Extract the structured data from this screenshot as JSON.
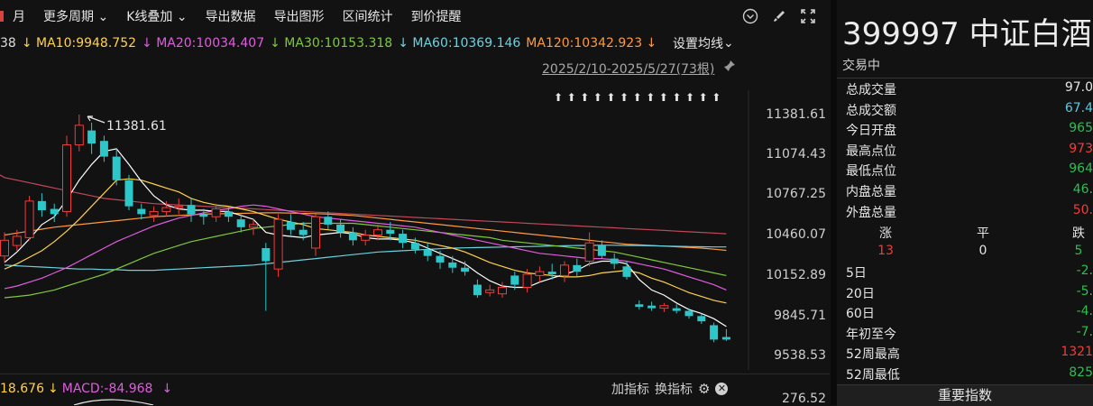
{
  "toolbar": {
    "items": [
      "月",
      "更多周期",
      "K线叠加",
      "导出数据",
      "导出图形",
      "区间统计",
      "到价提醒"
    ]
  },
  "ma": {
    "prefix": "38",
    "ma10": "MA10:9948.752",
    "ma20": "MA20:10034.407",
    "ma30": "MA30:10153.318",
    "ma60": "MA60:10369.146",
    "ma120": "MA120:10342.923",
    "settings": "设置均线"
  },
  "range_label": "2025/2/10-2025/5/27(73根)",
  "high_label": "11381.61",
  "axis": [
    "11381.61",
    "11074.43",
    "10767.25",
    "10460.07",
    "10152.89",
    "9845.71",
    "9538.53"
  ],
  "macd": {
    "prefix": "18.676",
    "macd": "MACD:-84.968",
    "add": "加指标",
    "switch": "换指标",
    "axis_val": "276.52"
  },
  "quote": {
    "title": "399997 中证白酒",
    "status": "交易中",
    "rows": [
      {
        "label": "总成交量",
        "value": "97.0",
        "color": "#e6e6e6"
      },
      {
        "label": "总成交额",
        "value": "67.4",
        "color": "#5ec8e0"
      },
      {
        "label": "今日开盘",
        "value": "965",
        "color": "#2bbf4f"
      },
      {
        "label": "最高点位",
        "value": "973",
        "color": "#f03c3c"
      },
      {
        "label": "最低点位",
        "value": "964",
        "color": "#2bbf4f"
      },
      {
        "label": "内盘总量",
        "value": "46.",
        "color": "#2bbf4f"
      },
      {
        "label": "外盘总量",
        "value": "50.",
        "color": "#f03c3c"
      }
    ],
    "updown_labels": [
      "涨",
      "平",
      "跌"
    ],
    "updown_values": [
      "13",
      "0",
      "5"
    ],
    "perf": [
      {
        "label": "5日",
        "value": "-2.",
        "color": "#2bbf4f"
      },
      {
        "label": "20日",
        "value": "-5.",
        "color": "#2bbf4f"
      },
      {
        "label": "60日",
        "value": "-4.",
        "color": "#2bbf4f"
      },
      {
        "label": "年初至今",
        "value": "-7.",
        "color": "#2bbf4f"
      },
      {
        "label": "52周最高",
        "value": "1321",
        "color": "#f03c3c"
      },
      {
        "label": "52周最低",
        "value": "825",
        "color": "#2bbf4f"
      }
    ],
    "bottom_button": "重要指数"
  },
  "colors": {
    "up": "#f03c3c",
    "down": "#2ec7c9",
    "ma10": "#ffd24a",
    "ma20": "#e05ce0",
    "ma30": "#7fc93a",
    "ma60": "#6ad3e0",
    "ma120": "#ff9a3c"
  },
  "chart_data": {
    "type": "candlestick",
    "ylim": [
      9538.53,
      11381.61
    ],
    "candles": [
      {
        "o": 10300,
        "c": 10420,
        "h": 10480,
        "l": 10250
      },
      {
        "o": 10380,
        "c": 10450,
        "h": 10500,
        "l": 10340
      },
      {
        "o": 10440,
        "c": 10720,
        "h": 10760,
        "l": 10420
      },
      {
        "o": 10720,
        "c": 10650,
        "h": 10780,
        "l": 10600
      },
      {
        "o": 10660,
        "c": 10620,
        "h": 10700,
        "l": 10560
      },
      {
        "o": 10640,
        "c": 11150,
        "h": 11220,
        "l": 10600
      },
      {
        "o": 11150,
        "c": 11300,
        "h": 11381.61,
        "l": 11100
      },
      {
        "o": 11260,
        "c": 11160,
        "h": 11320,
        "l": 11080
      },
      {
        "o": 11180,
        "c": 11060,
        "h": 11220,
        "l": 11020
      },
      {
        "o": 11060,
        "c": 10880,
        "h": 11120,
        "l": 10840
      },
      {
        "o": 10880,
        "c": 10680,
        "h": 10920,
        "l": 10650
      },
      {
        "o": 10660,
        "c": 10620,
        "h": 10700,
        "l": 10580
      },
      {
        "o": 10610,
        "c": 10640,
        "h": 10680,
        "l": 10560
      },
      {
        "o": 10640,
        "c": 10670,
        "h": 10720,
        "l": 10600
      },
      {
        "o": 10670,
        "c": 10680,
        "h": 10740,
        "l": 10620
      },
      {
        "o": 10690,
        "c": 10620,
        "h": 10740,
        "l": 10560
      },
      {
        "o": 10620,
        "c": 10600,
        "h": 10660,
        "l": 10540
      },
      {
        "o": 10600,
        "c": 10660,
        "h": 10700,
        "l": 10560
      },
      {
        "o": 10640,
        "c": 10600,
        "h": 10680,
        "l": 10560
      },
      {
        "o": 10580,
        "c": 10520,
        "h": 10620,
        "l": 10480
      },
      {
        "o": 10520,
        "c": 10540,
        "h": 10580,
        "l": 10460
      },
      {
        "o": 10360,
        "c": 10260,
        "h": 10400,
        "l": 9880
      },
      {
        "o": 10200,
        "c": 10580,
        "h": 10620,
        "l": 10140
      },
      {
        "o": 10560,
        "c": 10500,
        "h": 10620,
        "l": 10460
      },
      {
        "o": 10500,
        "c": 10460,
        "h": 10560,
        "l": 10420
      },
      {
        "o": 10360,
        "c": 10600,
        "h": 10620,
        "l": 10300
      },
      {
        "o": 10600,
        "c": 10540,
        "h": 10640,
        "l": 10500
      },
      {
        "o": 10540,
        "c": 10480,
        "h": 10580,
        "l": 10440
      },
      {
        "o": 10480,
        "c": 10420,
        "h": 10520,
        "l": 10380
      },
      {
        "o": 10420,
        "c": 10460,
        "h": 10500,
        "l": 10380
      },
      {
        "o": 10460,
        "c": 10500,
        "h": 10540,
        "l": 10420
      },
      {
        "o": 10500,
        "c": 10470,
        "h": 10560,
        "l": 10420
      },
      {
        "o": 10470,
        "c": 10400,
        "h": 10500,
        "l": 10360
      },
      {
        "o": 10400,
        "c": 10350,
        "h": 10440,
        "l": 10320
      },
      {
        "o": 10350,
        "c": 10300,
        "h": 10400,
        "l": 10260
      },
      {
        "o": 10300,
        "c": 10250,
        "h": 10340,
        "l": 10200
      },
      {
        "o": 10250,
        "c": 10210,
        "h": 10300,
        "l": 10170
      },
      {
        "o": 10210,
        "c": 10180,
        "h": 10260,
        "l": 10150
      },
      {
        "o": 10080,
        "c": 10000,
        "h": 10120,
        "l": 9980
      },
      {
        "o": 10020,
        "c": 10040,
        "h": 10080,
        "l": 9990
      },
      {
        "o": 10010,
        "c": 10060,
        "h": 10100,
        "l": 9980
      },
      {
        "o": 10150,
        "c": 10080,
        "h": 10180,
        "l": 10040
      },
      {
        "o": 10060,
        "c": 10160,
        "h": 10200,
        "l": 10020
      },
      {
        "o": 10150,
        "c": 10180,
        "h": 10220,
        "l": 10100
      },
      {
        "o": 10180,
        "c": 10160,
        "h": 10240,
        "l": 10120
      },
      {
        "o": 10150,
        "c": 10230,
        "h": 10260,
        "l": 10100
      },
      {
        "o": 10230,
        "c": 10180,
        "h": 10280,
        "l": 10140
      },
      {
        "o": 10260,
        "c": 10400,
        "h": 10480,
        "l": 10220
      },
      {
        "o": 10380,
        "c": 10300,
        "h": 10420,
        "l": 10280
      },
      {
        "o": 10280,
        "c": 10240,
        "h": 10320,
        "l": 10200
      },
      {
        "o": 10220,
        "c": 10140,
        "h": 10260,
        "l": 10120
      },
      {
        "o": 9930,
        "c": 9910,
        "h": 9960,
        "l": 9890
      },
      {
        "o": 9920,
        "c": 9900,
        "h": 9950,
        "l": 9880
      },
      {
        "o": 9900,
        "c": 9920,
        "h": 9940,
        "l": 9870
      },
      {
        "o": 9900,
        "c": 9880,
        "h": 9930,
        "l": 9860
      },
      {
        "o": 9880,
        "c": 9840,
        "h": 9900,
        "l": 9820
      },
      {
        "o": 9840,
        "c": 9800,
        "h": 9860,
        "l": 9780
      },
      {
        "o": 9770,
        "c": 9660,
        "h": 9790,
        "l": 9640
      },
      {
        "o": 9680,
        "c": 9660,
        "h": 9740,
        "l": 9650
      }
    ],
    "ma_lines": {
      "ma5": [
        10250,
        10330,
        10430,
        10540,
        10600,
        10730,
        10880,
        11000,
        11100,
        11120,
        11000,
        10870,
        10760,
        10690,
        10660,
        10650,
        10650,
        10640,
        10640,
        10610,
        10580,
        10480,
        10460,
        10450,
        10440,
        10460,
        10470,
        10480,
        10470,
        10440,
        10430,
        10430,
        10420,
        10400,
        10360,
        10320,
        10280,
        10240,
        10170,
        10110,
        10070,
        10060,
        10060,
        10100,
        10130,
        10160,
        10190,
        10240,
        10260,
        10260,
        10240,
        10120,
        10040,
        10000,
        9940,
        9890,
        9860,
        9820,
        9760
      ],
      "ma10": [
        10200,
        10240,
        10290,
        10340,
        10410,
        10490,
        10580,
        10680,
        10780,
        10880,
        10890,
        10880,
        10850,
        10820,
        10790,
        10740,
        10710,
        10690,
        10680,
        10660,
        10640,
        10610,
        10580,
        10560,
        10540,
        10510,
        10500,
        10490,
        10480,
        10460,
        10450,
        10440,
        10430,
        10420,
        10400,
        10380,
        10360,
        10330,
        10290,
        10250,
        10220,
        10190,
        10170,
        10160,
        10150,
        10140,
        10140,
        10150,
        10170,
        10180,
        10190,
        10170,
        10130,
        10100,
        10060,
        10020,
        9990,
        9960,
        9940
      ],
      "ma20": [
        10050,
        10070,
        10100,
        10130,
        10170,
        10210,
        10260,
        10310,
        10360,
        10410,
        10450,
        10490,
        10530,
        10560,
        10590,
        10610,
        10630,
        10650,
        10660,
        10680,
        10690,
        10680,
        10660,
        10640,
        10620,
        10600,
        10590,
        10580,
        10570,
        10560,
        10550,
        10540,
        10530,
        10520,
        10500,
        10480,
        10460,
        10440,
        10420,
        10400,
        10380,
        10360,
        10340,
        10320,
        10310,
        10300,
        10290,
        10280,
        10280,
        10270,
        10260,
        10240,
        10220,
        10200,
        10170,
        10140,
        10110,
        10080,
        10040
      ],
      "ma30": [
        9980,
        9990,
        10000,
        10020,
        10040,
        10070,
        10100,
        10130,
        10160,
        10200,
        10240,
        10280,
        10320,
        10350,
        10380,
        10410,
        10430,
        10450,
        10470,
        10490,
        10510,
        10520,
        10530,
        10540,
        10550,
        10550,
        10550,
        10550,
        10550,
        10540,
        10530,
        10520,
        10510,
        10500,
        10490,
        10480,
        10470,
        10460,
        10450,
        10440,
        10420,
        10410,
        10400,
        10390,
        10380,
        10370,
        10360,
        10350,
        10340,
        10330,
        10310,
        10290,
        10270,
        10250,
        10230,
        10210,
        10190,
        10170,
        10150
      ],
      "ma60": [
        10230,
        10225,
        10220,
        10215,
        10210,
        10205,
        10200,
        10200,
        10195,
        10195,
        10190,
        10190,
        10190,
        10195,
        10200,
        10205,
        10210,
        10215,
        10220,
        10225,
        10230,
        10240,
        10250,
        10260,
        10270,
        10280,
        10290,
        10300,
        10310,
        10320,
        10330,
        10335,
        10340,
        10345,
        10350,
        10355,
        10360,
        10362,
        10364,
        10366,
        10368,
        10370,
        10372,
        10374,
        10376,
        10378,
        10380,
        10381,
        10382,
        10382,
        10381,
        10380,
        10378,
        10376,
        10374,
        10372,
        10370,
        10369,
        10369
      ],
      "ma120": [
        10460,
        10475,
        10490,
        10505,
        10520,
        10530,
        10540,
        10550,
        10560,
        10570,
        10580,
        10590,
        10600,
        10605,
        10610,
        10615,
        10620,
        10622,
        10624,
        10626,
        10628,
        10630,
        10630,
        10628,
        10626,
        10624,
        10620,
        10615,
        10610,
        10600,
        10590,
        10580,
        10570,
        10560,
        10550,
        10540,
        10530,
        10520,
        10510,
        10500,
        10490,
        10480,
        10470,
        10460,
        10450,
        10440,
        10430,
        10420,
        10410,
        10400,
        10390,
        10385,
        10380,
        10375,
        10370,
        10365,
        10360,
        10352,
        10343
      ],
      "ma250": [
        10900,
        10880,
        10860,
        10840,
        10820,
        10800,
        10780,
        10760,
        10740,
        10730,
        10720,
        10710,
        10700,
        10695,
        10690,
        10685,
        10680,
        10675,
        10670,
        10665,
        10660,
        10655,
        10650,
        10645,
        10640,
        10635,
        10630,
        10625,
        10620,
        10615,
        10610,
        10605,
        10600,
        10595,
        10590,
        10585,
        10580,
        10575,
        10570,
        10565,
        10560,
        10555,
        10550,
        10545,
        10540,
        10535,
        10530,
        10525,
        10520,
        10515,
        10510,
        10505,
        10500,
        10495,
        10490,
        10485,
        10480,
        10475,
        10470
      ]
    }
  }
}
